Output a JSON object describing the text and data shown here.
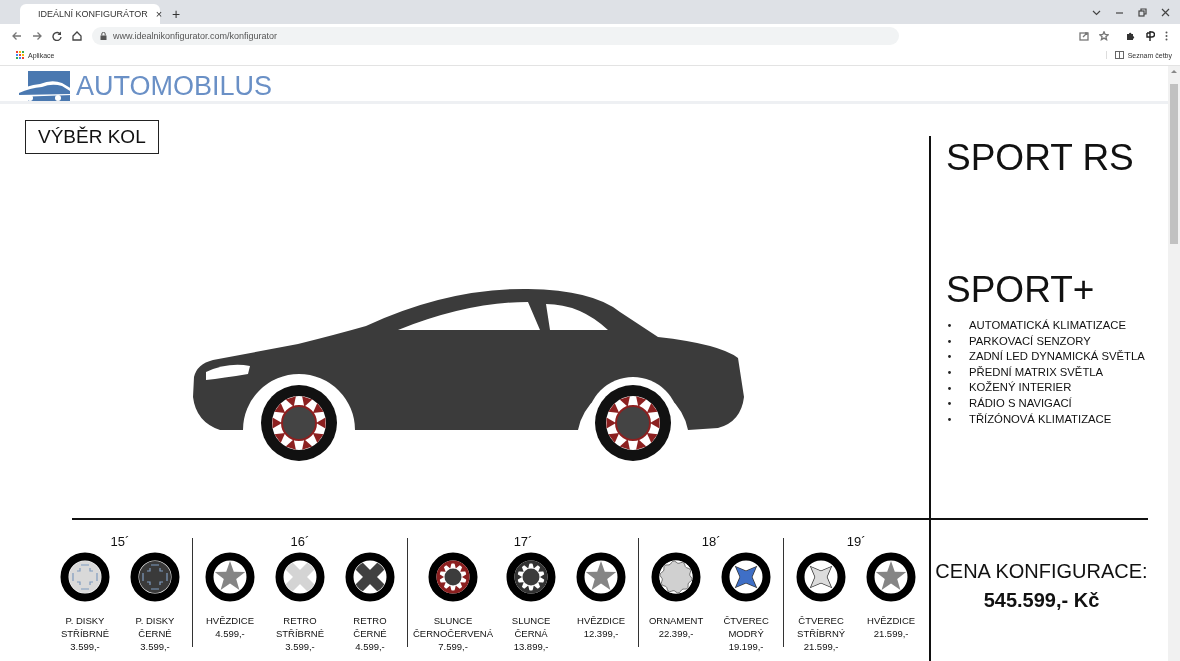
{
  "browser": {
    "tab_title": "IDEÁLNÍ KONFIGURÁTOR",
    "tab_close": "×",
    "new_tab": "+",
    "url": "www.idealnikonfigurator.com/konfigurator",
    "apps_label": "Aplikace",
    "reading_list": "Seznam četby"
  },
  "site": {
    "logo": "AUTOMOBILUS"
  },
  "section_button": "VÝBĚR KOL",
  "trim": {
    "model": "SPORT RS",
    "package": "SPORT+",
    "features": [
      "AUTOMATICKÁ KLIMATIZACE",
      "PARKOVACÍ SENZORY",
      "ZADNÍ LED DYNAMICKÁ SVĚTLA",
      "PŘEDNÍ MATRIX SVĚTLA",
      "KOŽENÝ INTERIER",
      "RÁDIO S NAVIGACÍ",
      "TŘÍZÓNOVÁ KLIMATIZACE"
    ]
  },
  "wheel_groups": [
    {
      "size": "15´",
      "wheels": [
        {
          "name": "P. DISKY\nSTŘÍBRNÉ",
          "price": "3.599,-",
          "kind": "plate",
          "color": "#d9d9d9"
        },
        {
          "name": "P. DISKY\nČERNÉ",
          "price": "3.599,-",
          "kind": "plate",
          "color": "#3a3a3a"
        }
      ]
    },
    {
      "size": "16´",
      "wheels": [
        {
          "name": "HVĚZDICE",
          "price": "4.599,-",
          "kind": "star",
          "color": "#858585"
        },
        {
          "name": "RETRO\nSTŘÍBRNÉ",
          "price": "3.599,-",
          "kind": "cross",
          "color": "#d4d4d4"
        },
        {
          "name": "RETRO\nČERNÉ",
          "price": "4.599,-",
          "kind": "cross",
          "color": "#404040"
        }
      ]
    },
    {
      "size": "17´",
      "wheels": [
        {
          "name": "SLUNCE\nČERNOČERVENÁ",
          "price": "7.599,-",
          "kind": "sun",
          "color": "#8c2020"
        },
        {
          "name": "SLUNCE\nČERNÁ",
          "price": "13.899,-",
          "kind": "sun",
          "color": "#333333"
        },
        {
          "name": "HVĚZDICE",
          "price": "12.399,-",
          "kind": "star",
          "color": "#858585"
        }
      ]
    },
    {
      "size": "18´",
      "wheels": [
        {
          "name": "ORNAMENT",
          "price": "22.399,-",
          "kind": "ornament",
          "color": "#d0d0d0"
        },
        {
          "name": "ČTVEREC\nMODRÝ",
          "price": "19.199,-",
          "kind": "diamond",
          "color": "#3f6fc6"
        }
      ]
    },
    {
      "size": "19´",
      "wheels": [
        {
          "name": "ČTVEREC\nSTŘÍBRNÝ",
          "price": "21.599,-",
          "kind": "diamond",
          "color": "#dcdcdc"
        },
        {
          "name": "HVĚZDICE",
          "price": "21.599,-",
          "kind": "star",
          "color": "#858585"
        }
      ]
    }
  ],
  "price": {
    "label": "CENA KONFIGURACE:",
    "value": "545.599,- Kč"
  }
}
